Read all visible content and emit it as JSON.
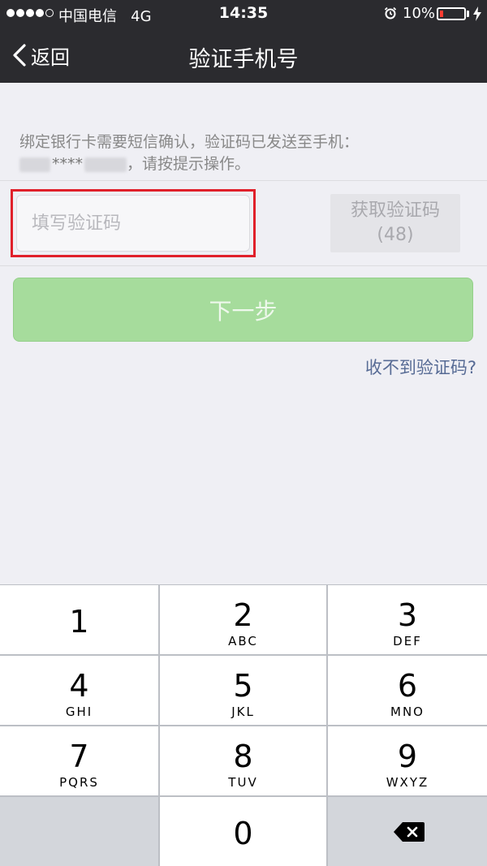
{
  "status_bar": {
    "carrier": "中国电信",
    "network": "4G",
    "time": "14:35",
    "battery": "10%",
    "signal_dots_filled": 4,
    "signal_dots_total": 5
  },
  "nav": {
    "back_label": "返回",
    "title": "验证手机号"
  },
  "info": {
    "line1": "绑定银行卡需要短信确认，验证码已发送至手机：",
    "masked_stars": "****",
    "line2_suffix": "，请按提示操作。"
  },
  "code_input": {
    "placeholder": "填写验证码",
    "value": ""
  },
  "get_code_button": {
    "label": "获取验证码",
    "countdown": "(48)"
  },
  "next_button": {
    "label": "下一步",
    "color": "#a6dc9c"
  },
  "no_code_link": {
    "label": "收不到验证码?",
    "color": "#576b95"
  },
  "highlight": {
    "color": "#e0202a"
  },
  "keypad": {
    "keys": [
      {
        "digit": "1",
        "letters": ""
      },
      {
        "digit": "2",
        "letters": "ABC"
      },
      {
        "digit": "3",
        "letters": "DEF"
      },
      {
        "digit": "4",
        "letters": "GHI"
      },
      {
        "digit": "5",
        "letters": "JKL"
      },
      {
        "digit": "6",
        "letters": "MNO"
      },
      {
        "digit": "7",
        "letters": "PQRS"
      },
      {
        "digit": "8",
        "letters": "TUV"
      },
      {
        "digit": "9",
        "letters": "WXYZ"
      },
      {
        "digit": "0",
        "letters": ""
      }
    ],
    "delete_icon": "backspace-icon"
  }
}
